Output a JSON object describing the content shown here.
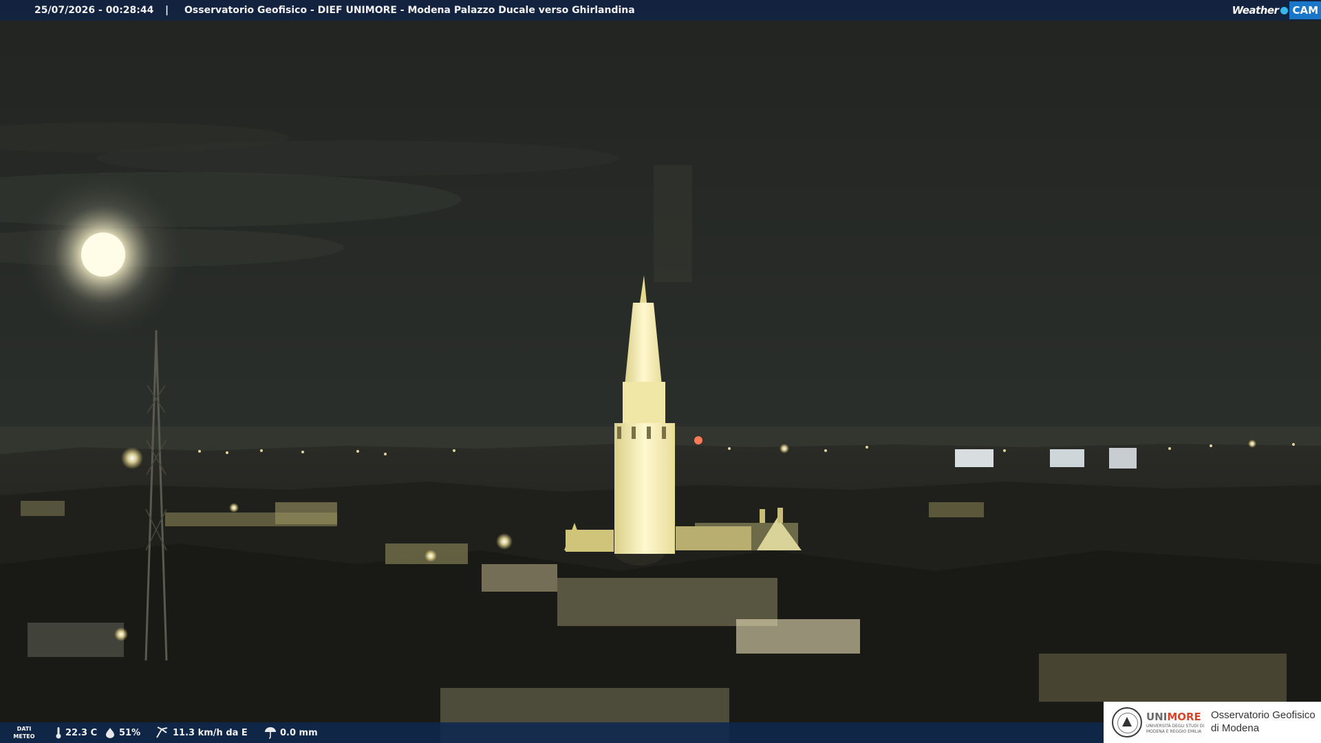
{
  "header": {
    "timestamp": "25/07/2026 - 00:28:44",
    "separator": "|",
    "title": "Osservatorio Geofisico - DIEF UNIMORE - Modena Palazzo Ducale verso Ghirlandina",
    "brand_weather": "Weather",
    "brand_cam": "CAM"
  },
  "weather_bar": {
    "label_line1": "DATI",
    "label_line2": "METEO",
    "temperature": "22.3 C",
    "humidity": "51%",
    "wind": "11.3 km/h da E",
    "rain": "0.0 mm",
    "icons": [
      "thermometer-icon",
      "humidity-icon",
      "wind-icon",
      "rain-icon"
    ]
  },
  "logo": {
    "brand_uni": "UNI",
    "brand_more": "MORE",
    "brand_sub_line1": "UNIVERSITÀ DEGLI STUDI DI",
    "brand_sub_line2": "MODENA E REGGIO EMILIA",
    "org_line1": "Osservatorio Geofisico",
    "org_line2": "di Modena"
  },
  "colors": {
    "sky": "#262a26",
    "tower_light": "#fff6c0",
    "bar_blue": "#122442",
    "accent_red": "#d8432b",
    "cam_blue": "#1976c8"
  }
}
